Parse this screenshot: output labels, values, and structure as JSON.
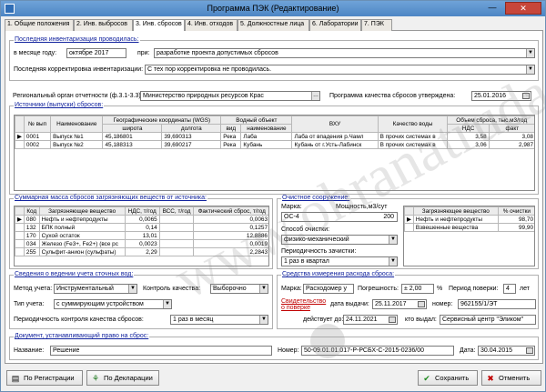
{
  "window": {
    "title": "Программа ПЭК (Редактирование)",
    "minimize": "—",
    "close": "✕"
  },
  "tabs": [
    "1. Общие положения",
    "2. Инв. выбросов",
    "3. Инв. сбросов",
    "4. Инв. отходов",
    "5. Должностные лица",
    "6. Лаборатории",
    "7. ПЭК"
  ],
  "inventory": {
    "title": "Последняя инвентаризация проводилась:",
    "month_label": "в месяце году:",
    "month_value": "октябре 2017",
    "when_label": "при:",
    "when_value": "разработке проекта допустимых сбросов",
    "last_adj_label": "Последняя корректировка инвентаризации:",
    "last_adj_value": "С тех пор корректировка не проводилась."
  },
  "regional_label": "Региональный орган отчетности (ф.3.1-3.3):",
  "regional_value": "Министерство природных ресурсов Крас",
  "program_label": "Программа качества сбросов утверждена:",
  "program_date": "25.01.2016",
  "sources": {
    "title": "Источники (выпуски) сбросов:",
    "headers": [
      "№ вып",
      "Наименование",
      "Географические координаты (WGS)",
      "широта",
      "долгота",
      "Водный объект",
      "вид",
      "наименование",
      "ВХУ",
      "Качество воды",
      "Объем сброса, тыс.м3/год",
      "НДС",
      "факт"
    ],
    "rows": [
      [
        "0001",
        "Выпуск №1",
        "45,186801",
        "39,690313",
        "Река",
        "Лаба",
        "Лаба от впадения р.Чамл",
        "В прочих системах в",
        "3,58",
        "3,08"
      ],
      [
        "0002",
        "Выпуск №2",
        "45,188313",
        "39,690217",
        "Река",
        "Кубань",
        "Кубань от г.Усть-Лабинск",
        "В прочих системах в",
        "3,06",
        "2,987"
      ]
    ]
  },
  "summary": {
    "title": "Суммарная масса сбросов загрязняющих веществ от источника:",
    "headers": [
      "Код",
      "Загрязняющее вещество",
      "НДС, т/год",
      "ВСС, т/год",
      "Фактический сброс, т/год"
    ],
    "rows": [
      [
        "080",
        "Нефть и нефтепродукты",
        "0,0065",
        "",
        "0,0063"
      ],
      [
        "132",
        "БПК полный",
        "0,14",
        "",
        "0,1257"
      ],
      [
        "170",
        "Сухой остаток",
        "13,01",
        "",
        "12,8886"
      ],
      [
        "034",
        "Железо (Fe3+, Fe2+) (все рс",
        "0,0023",
        "",
        "0,0019"
      ],
      [
        "255",
        "Сульфит-анион (сульфаты)",
        "2,29",
        "",
        "2,2843"
      ]
    ]
  },
  "treatment": {
    "title": "Очистное сооружение:",
    "mark_label": "Марка:",
    "power_label": "Мощность,м3/сут",
    "mark_value": "ОС-4",
    "power_value": "200",
    "method_label": "Способ очистки:",
    "method_value": "физико-механический",
    "period_label": "Периодичность зачистки:",
    "period_value": "1 раз в квартал",
    "table_headers": [
      "Загрязняющее вещество",
      "% очистки"
    ],
    "table_rows": [
      [
        "Нефть и нефтепродукты",
        "98,70"
      ],
      [
        "Взвешенные вещества",
        "99,90"
      ]
    ]
  },
  "accounting": {
    "title": "Сведения о ведении учета сточных вод:",
    "method_label": "Метод учета:",
    "method_value": "Инструментальный",
    "control_label": "Контроль качества:",
    "control_value": "Выборочно",
    "type_label": "Тип учета:",
    "type_value": "с суммирующим устройством",
    "period_label": "Периодичность контроля качества сбросов:",
    "period_value": "1 раз в месяц"
  },
  "measuring": {
    "title": "Средства измерения расхода сброса:",
    "mark_label": "Марка:",
    "mark_value": "Расходомер у",
    "error_label": "Погрешность:",
    "error_value": "± 2,00",
    "error_unit": "%",
    "period_label": "Период поверки:",
    "period_value": "4",
    "period_unit": "лет",
    "cert_label": "Свидетельство о поверке",
    "issue_label": "дата выдачи:",
    "issue_value": "25.11.2017",
    "number_label": "номер:",
    "number_value": "962155/1/ЭТ",
    "valid_label": "действует до:",
    "valid_value": "24.11.2021",
    "issuer_label": "кто выдал:",
    "issuer_value": "Сервисный центр \"Эликом\""
  },
  "document": {
    "title": "Документ, устанавливающий право на сброс:",
    "name_label": "Название:",
    "name_value": "Решение",
    "number_label": "Номер:",
    "number_value": "50-09.01.01.017-Р-РСБХ-С-2015-0236/00",
    "date_label": "Дата:",
    "date_value": "30.04.2015"
  },
  "buttons": {
    "by_registration": "По Регистрации",
    "by_declaration": "По Декларации",
    "save": "Сохранить",
    "cancel": "Отменить"
  },
  "watermark": "www.ohranatruda.ru"
}
